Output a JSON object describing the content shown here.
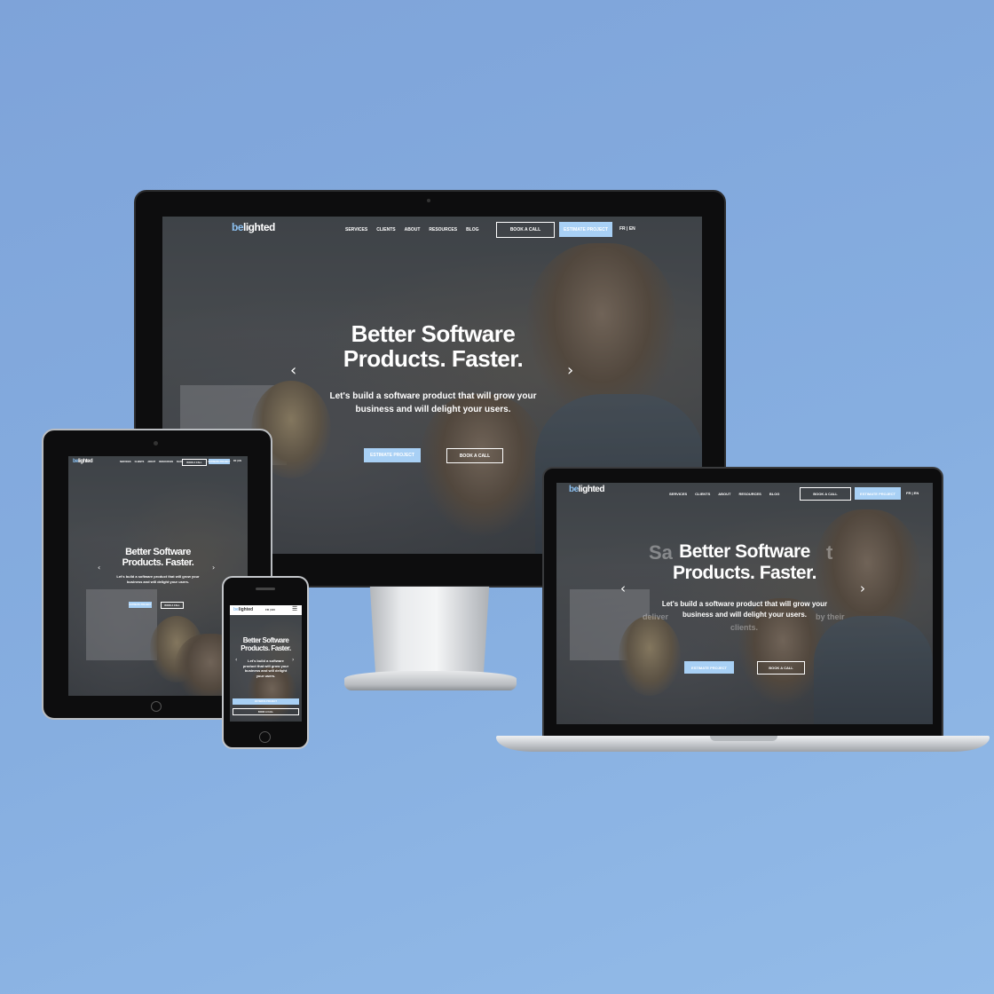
{
  "site": {
    "logo": "belighted",
    "logo_accent": "be",
    "logo_rest": "lighted",
    "nav": [
      "SERVICES",
      "CLIENTS",
      "ABOUT",
      "RESOURCES",
      "BLOG"
    ],
    "book_call": "BOOK A CALL",
    "estimate_project": "ESTIMATE PROJECT",
    "lang": "FR | EN",
    "title_line1": "Better Software",
    "title_line2": "Products. Faster.",
    "subtitle_line1": "Let's build a software product that will grow your",
    "subtitle_line2": "business and will delight your users.",
    "cta_estimate": "ESTIMATE PROJECT",
    "cta_book": "BOOK A CALL",
    "prev_arrow": "‹",
    "next_arrow": "›"
  },
  "laptop_ghost": {
    "title_ghost_left": "Sa",
    "title_ghost_right": "t",
    "sub_ghost_left": "deliver",
    "sub_ghost_right": "by their",
    "sub_ghost_line3": "clients."
  },
  "tablet": {
    "subtitle_line1": "Let's build a software product that will grow your",
    "subtitle_line2": "business and will delight your users."
  },
  "phone": {
    "lang": "FR | EN",
    "menu_icon": "☰",
    "subtitle_line1": "Let's build a software",
    "subtitle_line2": "product that will grow your",
    "subtitle_line3": "business and will delight",
    "subtitle_line4": "your users."
  },
  "colors": {
    "background": "#86aee0",
    "accent": "#a8d0f5",
    "logo_accent": "#8cc0f0"
  }
}
